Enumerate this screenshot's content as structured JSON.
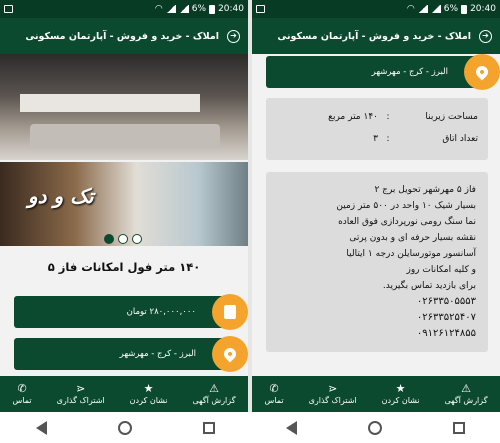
{
  "status": {
    "time": "20:40",
    "battery": "6%"
  },
  "appbar": {
    "title": "املاک - خرید و فروش - آپارتمان مسکونی"
  },
  "left": {
    "brand_text": "تک و دو",
    "ad_title": "۱۴۰ متر فول امکانات فاز ۵",
    "price": "۲۸۰,۰۰۰,۰۰۰ تومان",
    "location": "البرز - کرج - مهرشهر"
  },
  "right": {
    "location": "البرز - کرج - مهرشهر",
    "specs": [
      {
        "key": "مساحت زیربنا",
        "value": "۱۴۰ متر مربع"
      },
      {
        "key": "تعداد اتاق",
        "value": "۳"
      }
    ],
    "description": [
      "فاز ۵ مهرشهر تحویل برج ۲",
      "بسیار شیک ۱۰ واحد در ۵۰۰ متر زمین",
      "نما سنگ رومی نورپردازی فوق العاده",
      "نقشه بسیار حرفه ای و بدون پرتی",
      "آسانسور موتورسایلن درجه ۱ ایتالیا",
      "و کلیه امکانات روز",
      "برای بازدید تماس بگیرید.",
      "۰۲۶۳۳۵۰۵۵۵۳",
      "۰۲۶۳۳۵۲۵۴۰۷",
      "۰۹۱۲۶۱۲۴۸۵۵"
    ]
  },
  "bottomnav": {
    "items": [
      {
        "label": "گزارش آگهی",
        "icon": "warning-icon"
      },
      {
        "label": "نشان کردن",
        "icon": "star-icon"
      },
      {
        "label": "اشتراک گذاری",
        "icon": "share-icon"
      },
      {
        "label": "تماس",
        "icon": "phone-icon"
      }
    ]
  }
}
